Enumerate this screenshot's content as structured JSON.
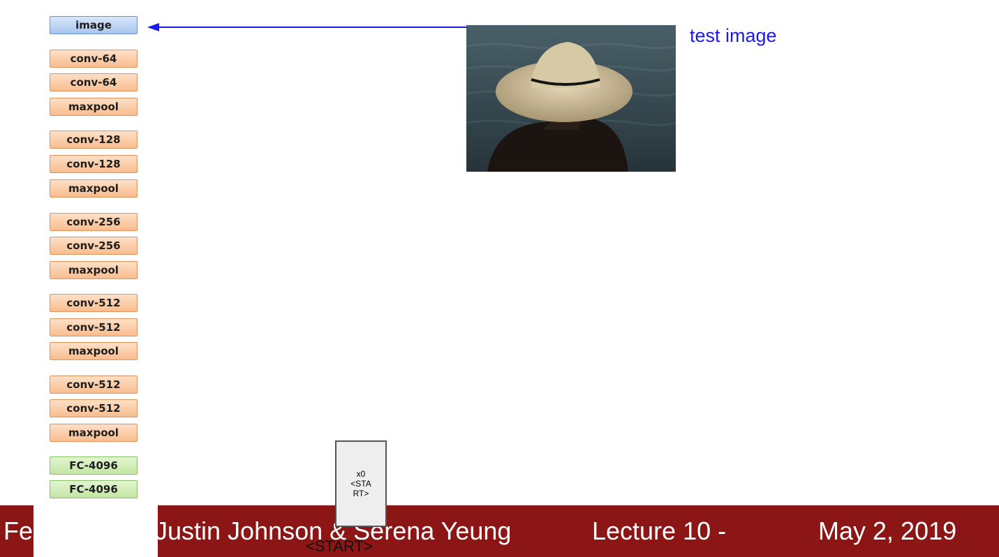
{
  "network": {
    "layers": [
      {
        "label": "image",
        "kind": "input"
      },
      {
        "label": "conv-64",
        "kind": "conv"
      },
      {
        "label": "conv-64",
        "kind": "conv"
      },
      {
        "label": "maxpool",
        "kind": "pool"
      },
      {
        "label": "conv-128",
        "kind": "conv"
      },
      {
        "label": "conv-128",
        "kind": "conv"
      },
      {
        "label": "maxpool",
        "kind": "pool"
      },
      {
        "label": "conv-256",
        "kind": "conv"
      },
      {
        "label": "conv-256",
        "kind": "conv"
      },
      {
        "label": "maxpool",
        "kind": "pool"
      },
      {
        "label": "conv-512",
        "kind": "conv"
      },
      {
        "label": "conv-512",
        "kind": "conv"
      },
      {
        "label": "maxpool",
        "kind": "pool"
      },
      {
        "label": "conv-512",
        "kind": "conv"
      },
      {
        "label": "conv-512",
        "kind": "conv"
      },
      {
        "label": "maxpool",
        "kind": "pool"
      },
      {
        "label": "FC-4096",
        "kind": "fc"
      },
      {
        "label": "FC-4096",
        "kind": "fc"
      }
    ]
  },
  "test_image": {
    "label": "test image",
    "icon": "photo-person-straw-hat-icon"
  },
  "arrow_color": "#1a1aee",
  "rnn_input": {
    "lines": [
      "x0",
      "<STA",
      "RT>"
    ],
    "token_label": "<START>"
  },
  "footer": {
    "left": "Fe",
    "authors": "Justin Johnson & Serena Yeung",
    "lecture": "Lecture 10 -",
    "date": "May 2, 2019",
    "color": "#8c1515"
  }
}
